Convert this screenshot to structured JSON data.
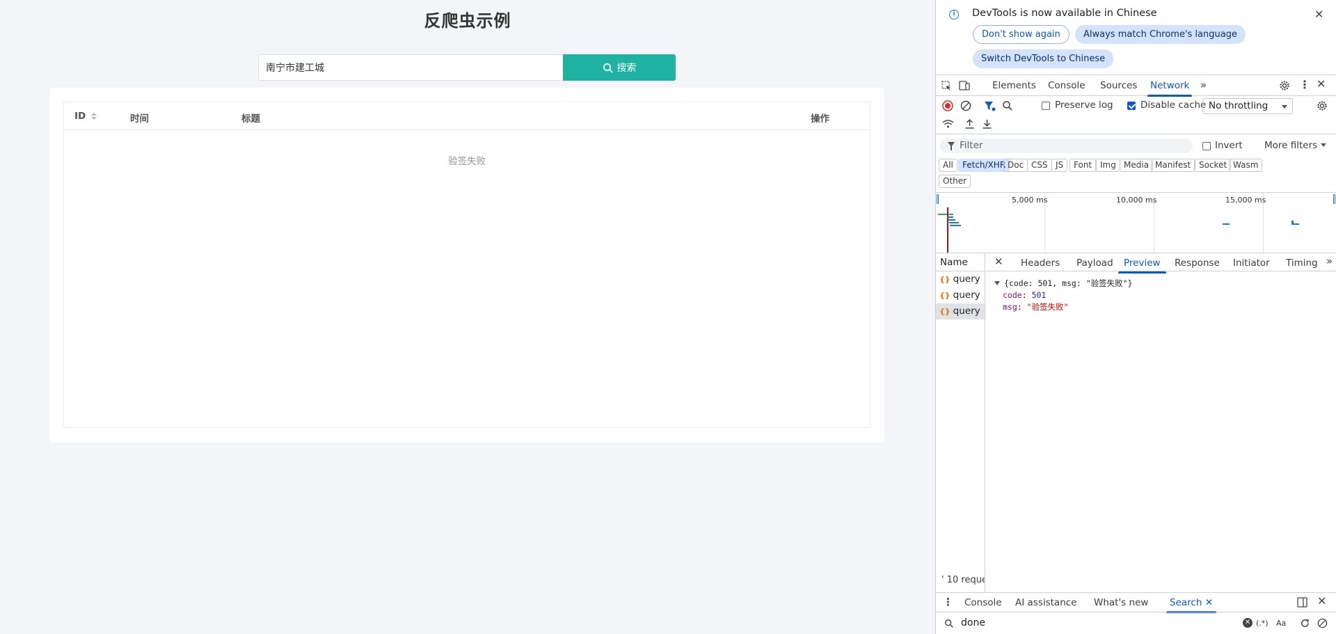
{
  "page": {
    "title": "反爬虫示例",
    "search": {
      "value": "南宁市建工城",
      "button_label": "搜索"
    },
    "table": {
      "columns": [
        "ID",
        "时间",
        "标题",
        "操作"
      ],
      "empty_text": "验签失败"
    }
  },
  "devtools": {
    "banner": {
      "text": "DevTools is now available in Chinese",
      "dont_show": "Don't show again",
      "always_match": "Always match Chrome's language",
      "switch": "Switch DevTools to Chinese"
    },
    "main_tabs": [
      "Elements",
      "Console",
      "Sources",
      "Network"
    ],
    "active_main_tab": "Network",
    "toolbar": {
      "preserve_log": "Preserve log",
      "preserve_log_checked": false,
      "disable_cache": "Disable cache",
      "disable_cache_checked": true,
      "throttling": "No throttling"
    },
    "filter": {
      "placeholder": "Filter",
      "invert": "Invert",
      "more_filters": "More filters"
    },
    "type_filters": [
      "All",
      "Fetch/XHR",
      "Doc",
      "CSS",
      "JS",
      "Font",
      "Img",
      "Media",
      "Manifest",
      "Socket",
      "Wasm",
      "Other"
    ],
    "active_type_filter": "Fetch/XHR",
    "overview": {
      "ticks": [
        "5,000 ms",
        "10,000 ms",
        "15,000 ms"
      ]
    },
    "requests": {
      "name_header": "Name",
      "items": [
        "query",
        "query",
        "query"
      ],
      "selected_index": 2,
      "count_text": "' 10 reque"
    },
    "detail_tabs": [
      "Headers",
      "Payload",
      "Preview",
      "Response",
      "Initiator",
      "Timing"
    ],
    "active_detail_tab": "Preview",
    "preview": {
      "summary": "{code: 501, msg: \"验签失败\"}",
      "code_key": "code",
      "code_value": "501",
      "msg_key": "msg",
      "msg_value": "\"验签失败\""
    },
    "drawer": {
      "tabs": [
        "Console",
        "AI assistance",
        "What's new",
        "Search"
      ],
      "active_tab": "Search",
      "search_query": "done",
      "regex_label": "(.*)",
      "case_label": "Aa"
    }
  },
  "colors": {
    "accent": "#1eb2a1",
    "devtools_blue": "#0b57d0"
  }
}
